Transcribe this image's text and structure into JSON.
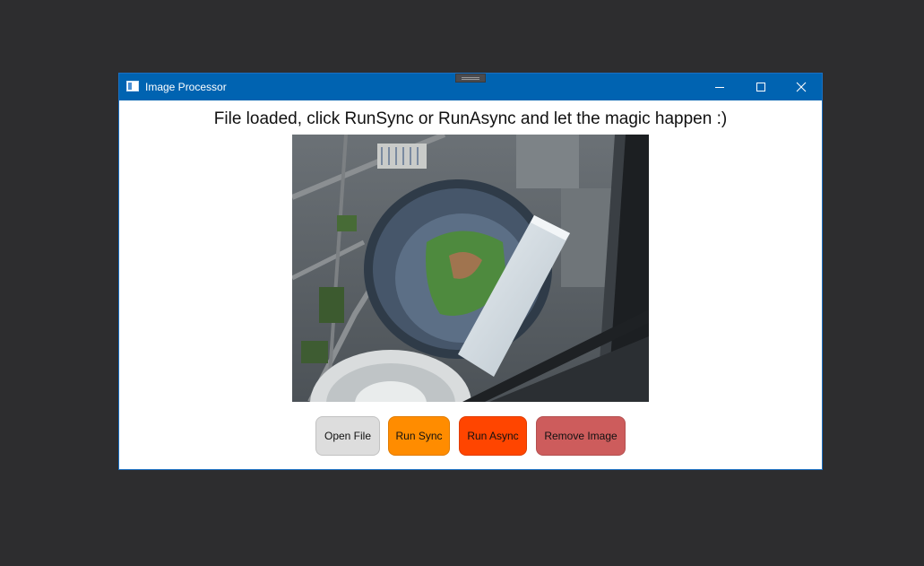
{
  "window": {
    "title": "Image Processor",
    "icon": "app-window-icon"
  },
  "caption_buttons": {
    "minimize_icon": "minimize-icon",
    "maximize_icon": "maximize-icon",
    "close_icon": "close-icon"
  },
  "main": {
    "status_message": "File loaded, click RunSync or RunAsync and let the magic happen :)",
    "image": {
      "description_icon": "loaded-photo"
    }
  },
  "buttons": [
    {
      "label": "Open File",
      "color": "#dddddd"
    },
    {
      "label": "Run Sync",
      "color": "#ff8c00"
    },
    {
      "label": "Run Async",
      "color": "#ff4500"
    },
    {
      "label": "Remove Image",
      "color": "#cd5c5c"
    }
  ],
  "colors": {
    "titlebar": "#0063b1",
    "desktop": "#2d2d2f",
    "window_bg": "#ffffff"
  }
}
